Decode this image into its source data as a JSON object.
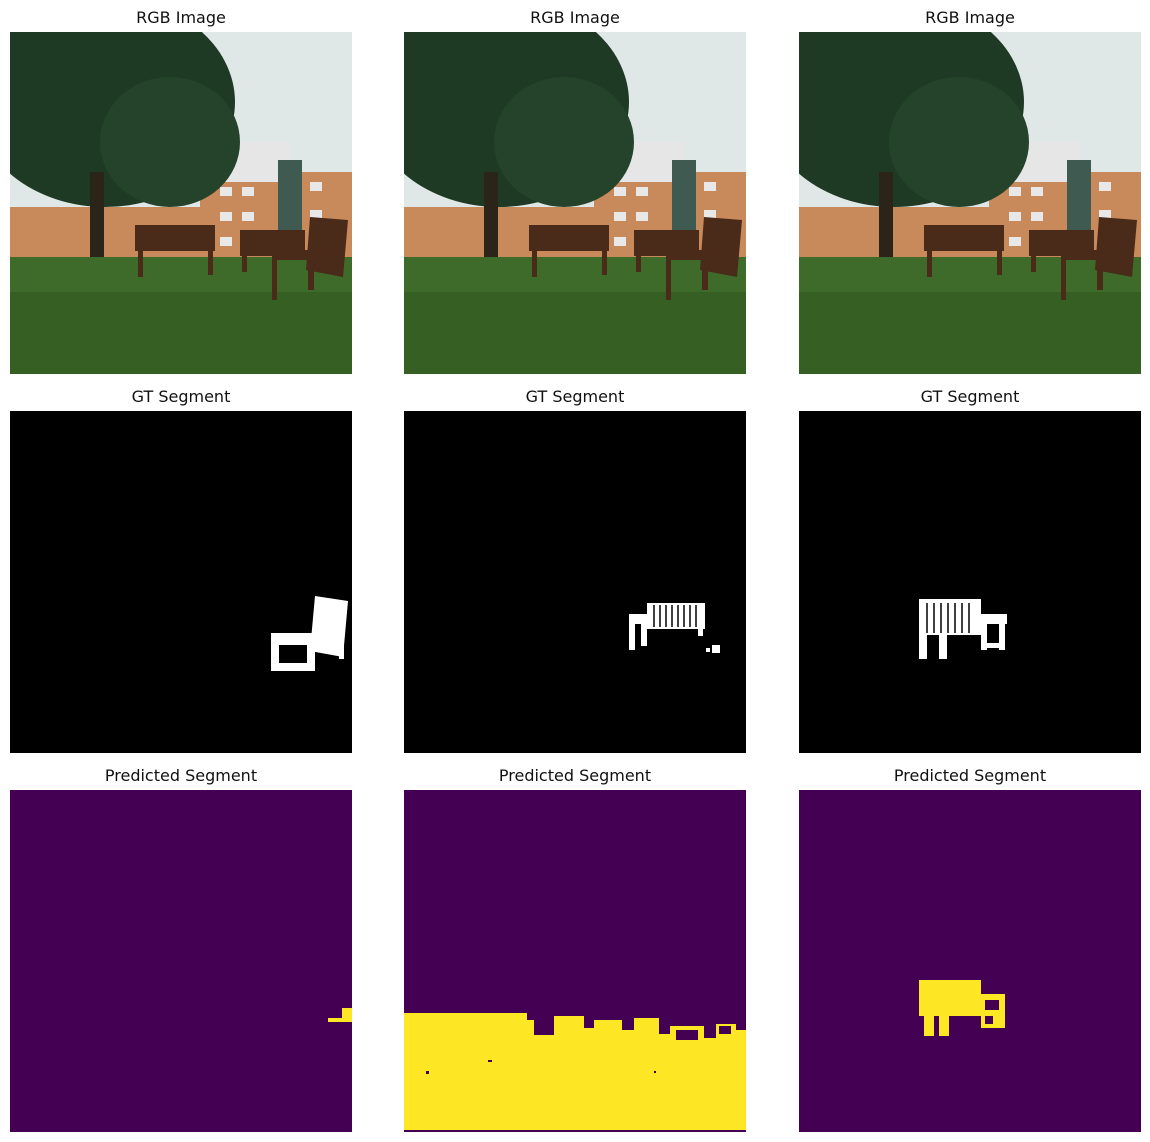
{
  "rows": [
    {
      "title": "RGB Image"
    },
    {
      "title": "GT Segment"
    },
    {
      "title": "Predicted Segment"
    }
  ],
  "columns": 3,
  "colors": {
    "background": "#ffffff",
    "gt_background": "#000000",
    "gt_foreground": "#ffffff",
    "pred_background": "#440154",
    "pred_foreground": "#fde725",
    "sky": "#dfe8e6",
    "tree": "#1f3a24",
    "building": "#c98a5b",
    "grass": "#3e6b2a",
    "bench": "#4a2a18"
  }
}
